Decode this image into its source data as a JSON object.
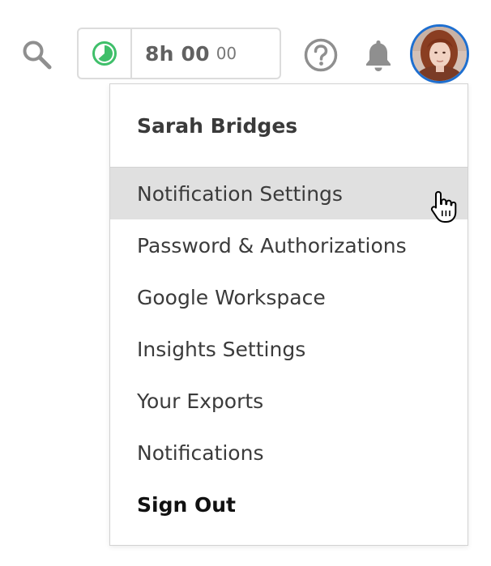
{
  "topbar": {
    "search": {
      "icon": "search-icon"
    },
    "timer": {
      "icon": "timer-clock-icon",
      "main": "8h 00",
      "seconds": "00",
      "accent_color": "#3fbf6a"
    },
    "help": {
      "icon": "help-circle-icon"
    },
    "notifications": {
      "icon": "bell-icon"
    },
    "avatar": {
      "accent_color": "#1e6fd0"
    }
  },
  "menu": {
    "user_name": "Sarah Bridges",
    "items": [
      {
        "label": "Notification Settings",
        "hovered": true
      },
      {
        "label": "Password & Authorizations"
      },
      {
        "label": "Google Workspace"
      },
      {
        "label": "Insights Settings"
      },
      {
        "label": "Your Exports"
      },
      {
        "label": "Notifications"
      },
      {
        "label": "Sign Out",
        "emphasis": true
      }
    ]
  },
  "colors": {
    "hover_background": "#e0e0e0",
    "border": "#d2d2d2",
    "icon_gray": "#8f8f8f"
  }
}
